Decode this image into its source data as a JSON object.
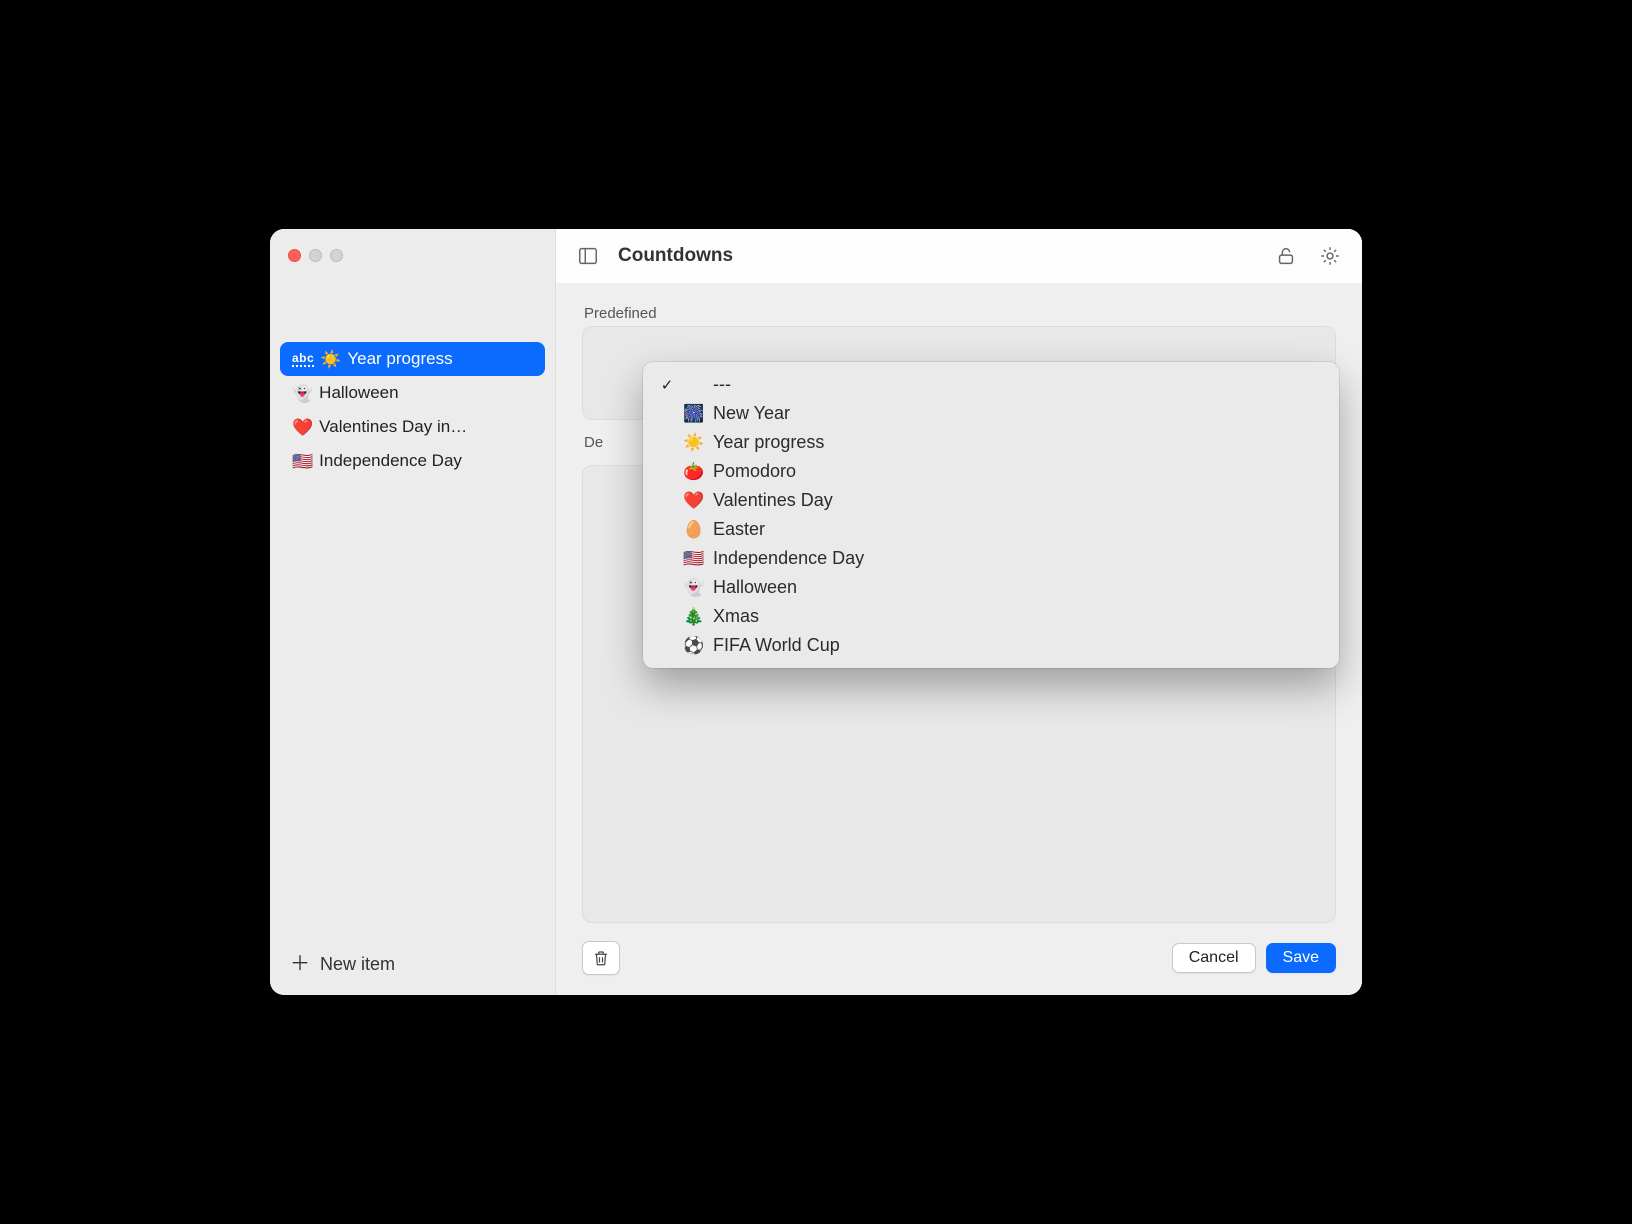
{
  "header": {
    "title": "Countdowns"
  },
  "sidebar": {
    "items": [
      {
        "badge": "abc",
        "emoji": "☀️",
        "label": "Year progress",
        "selected": true
      },
      {
        "emoji": "👻",
        "label": "Halloween"
      },
      {
        "emoji": "❤️",
        "label": "Valentines Day in…"
      },
      {
        "emoji": "🇺🇸",
        "label": "Independence Day"
      }
    ],
    "new_item_label": "New item"
  },
  "sections": {
    "predefined_label": "Predefined",
    "description_label_clip": "De"
  },
  "dropdown": {
    "selected_index": 0,
    "options": [
      {
        "emoji": "",
        "label": "---",
        "checked": true
      },
      {
        "emoji": "🎆",
        "label": "New Year"
      },
      {
        "emoji": "☀️",
        "label": "Year progress"
      },
      {
        "emoji": "🍅",
        "label": "Pomodoro"
      },
      {
        "emoji": "❤️",
        "label": "Valentines Day"
      },
      {
        "emoji": "🥚",
        "label": "Easter"
      },
      {
        "emoji": "🇺🇸",
        "label": "Independence Day"
      },
      {
        "emoji": "👻",
        "label": "Halloween"
      },
      {
        "emoji": "🎄",
        "label": "Xmas"
      },
      {
        "emoji": "⚽",
        "label": "FIFA World Cup"
      }
    ]
  },
  "footer": {
    "cancel_label": "Cancel",
    "save_label": "Save"
  }
}
